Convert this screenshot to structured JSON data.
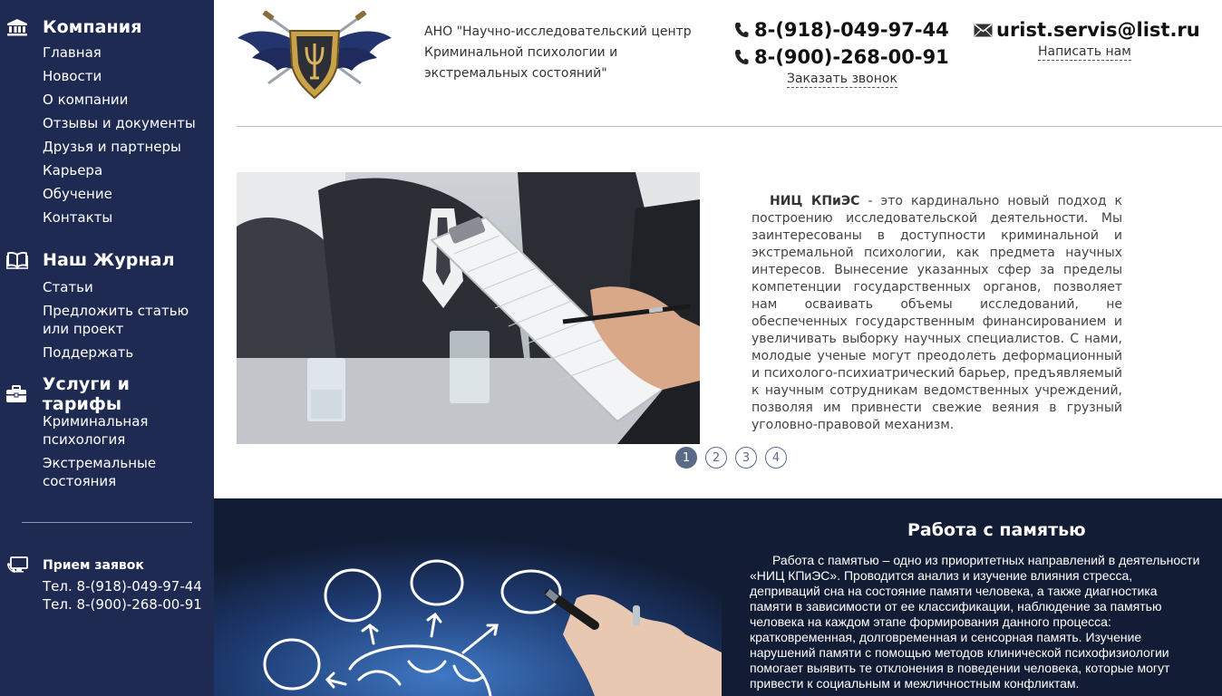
{
  "sidebar": {
    "company": {
      "title": "Компания",
      "items": [
        "Главная",
        "Новости",
        "О компании",
        "Отзывы и документы",
        "Друзья и партнеры",
        "Карьера",
        "Обучение",
        "Контакты"
      ]
    },
    "journal": {
      "title": "Наш Журнал",
      "items": [
        "Статьи",
        "Предложить статью или проект",
        "Поддержать"
      ]
    },
    "services": {
      "title": "Услуги и тарифы",
      "items": [
        "Криминальная психология",
        "Экстремальные состояния"
      ]
    },
    "contacts": {
      "title": "Прием заявок",
      "phone1": "Тел. 8-(918)-049-97-44",
      "phone2": "Тел. 8-(900)-268-00-91"
    }
  },
  "header": {
    "org_name": "АНО \"Научно-исследовательский центр Криминальной психологии и экстремальных состояний\"",
    "phone1": "8-(918)-049-97-44",
    "phone2": "8-(900)-268-00-91",
    "call_link": "Заказать звонок",
    "email": "urist.servis@list.ru",
    "write_link": "Написать нам"
  },
  "slider": {
    "lead": "НИЦ КПиЭС",
    "text": " - это кардинально новый подход к построению исследовательской деятельности. Мы заинтересованы в доступности криминальной и экстремальной психологии, как предмета научных интересов. Вынесение указанных сфер за пределы компетенции государственных органов, позволяет нам осваивать объемы исследований, не обеспеченных государственным финансированием и увеличивать выборку научных специалистов. С нами, молодые ученые могут преодолеть деформационный и психолого-психиатрический барьер, предъявляемый к научным сотрудникам ведомственных учреждений, позволяя им привнести свежие веяния в грузный уголовно-правовой механизм.",
    "pages": [
      "1",
      "2",
      "3",
      "4"
    ],
    "active_page": 1
  },
  "memory": {
    "title": "Работа с памятью",
    "text": "Работа с памятью – одно из приоритетных направлений в деятельности «НИЦ КПиЭС». Проводится анализ и изучение влияния стресса, деприваций сна на состояние памяти человека, а также диагностика памяти в зависимости от ее классификации, наблюдение за памятью человека на каждом этапе формирования данного процесса: кратковременная, долговременная и сенсорная память. Изучение нарушений памяти с помощью методов клинической психофизиологии помогает выявить те отклонения в поведении человека, которые могут привести к социальным и межличностным конфликтам."
  },
  "icons": {
    "company": "bank-icon",
    "journal": "book-icon",
    "services": "briefcase-icon",
    "contacts": "monitor-phone-icon",
    "phone": "phone-icon",
    "email": "envelope-icon"
  },
  "colors": {
    "sidebar_bg": "#1f2a52",
    "dark_section_bg": "#121c34",
    "pager_accent": "#5a6a86"
  }
}
